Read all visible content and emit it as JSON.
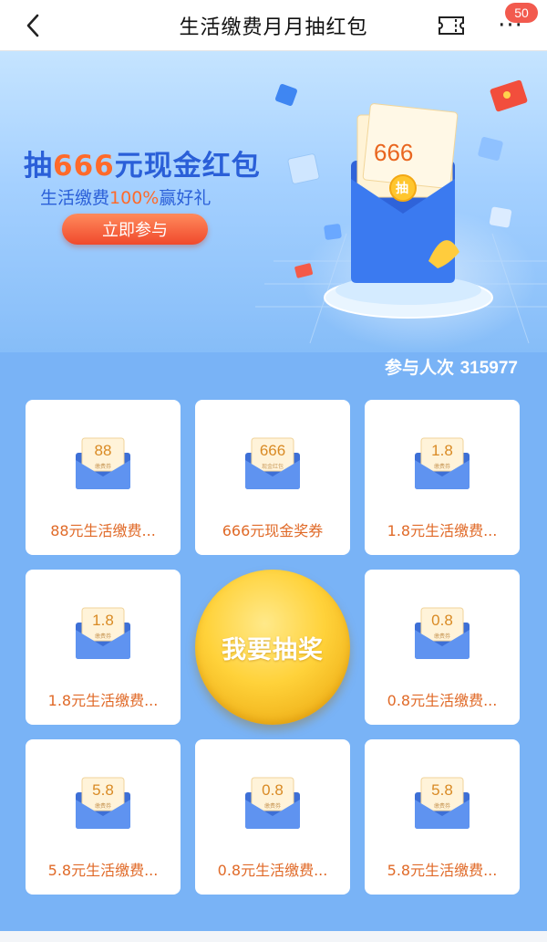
{
  "nav": {
    "title": "生活缴费月月抽红包",
    "badge": "50",
    "more": "···"
  },
  "banner": {
    "title_prefix": "抽",
    "title_amount": "666",
    "title_suffix": "元现金红包",
    "subtitle_prefix": "生活缴费",
    "subtitle_percent": "100%",
    "subtitle_suffix": "赢好礼",
    "cta": "立即参与",
    "envelope_amount": "666",
    "envelope_seal": "抽"
  },
  "participants": {
    "label": "参与人次",
    "count": "315977"
  },
  "prizes": [
    {
      "amount": "88",
      "tag": "缴费券",
      "label": "88元生活缴费..."
    },
    {
      "amount": "666",
      "tag": "现金红包",
      "label": "666元现金奖券"
    },
    {
      "amount": "1.8",
      "tag": "缴费券",
      "label": "1.8元生活缴费..."
    },
    {
      "amount": "1.8",
      "tag": "缴费券",
      "label": "1.8元生活缴费..."
    },
    {
      "amount": "0.8",
      "tag": "缴费券",
      "label": "0.8元生活缴费..."
    },
    {
      "amount": "5.8",
      "tag": "缴费券",
      "label": "5.8元生活缴费..."
    },
    {
      "amount": "0.8",
      "tag": "缴费券",
      "label": "0.8元生活缴费..."
    },
    {
      "amount": "5.8",
      "tag": "缴费券",
      "label": "5.8元生活缴费..."
    }
  ],
  "draw_button": "我要抽奖",
  "colors": {
    "background": "#79b3f6",
    "accent_orange": "#ff6a2a",
    "title_blue": "#2a5fd8",
    "badge_red": "#f25a4e",
    "gold": "#ffd23a"
  },
  "icons": [
    "back-arrow-icon",
    "ticket-icon",
    "more-icon"
  ]
}
